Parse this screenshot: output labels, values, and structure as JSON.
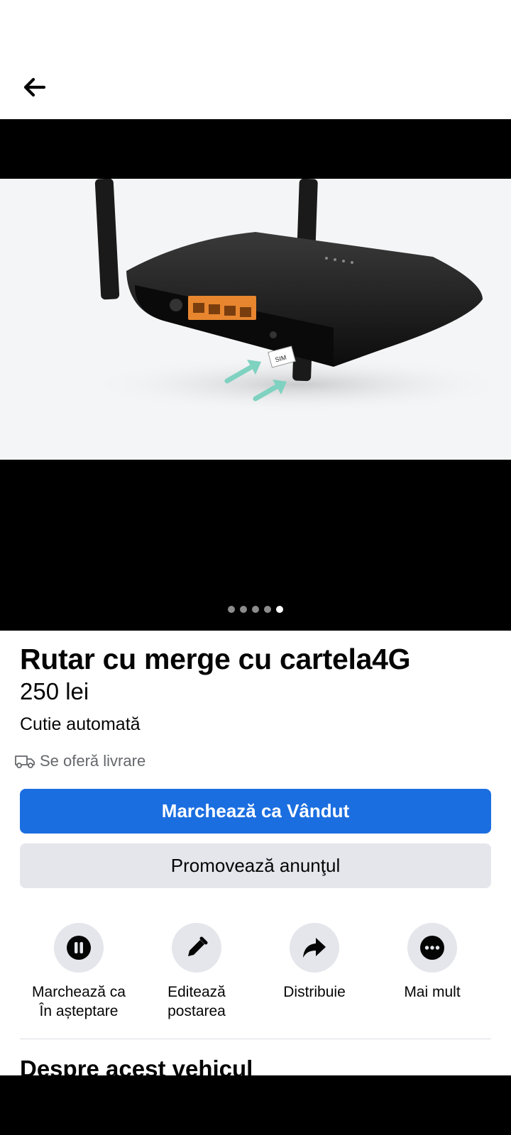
{
  "header": {
    "back_icon": "arrow-left-icon"
  },
  "gallery": {
    "image_alt": "TP-Link 4G LTE router with SIM card slot",
    "image_count": 5,
    "active_index": 5
  },
  "listing": {
    "title": "Rutar cu merge cu cartela4G",
    "price": "250 lei",
    "condition": "Cutie automată",
    "delivery_icon": "delivery-truck-icon",
    "delivery": "Se oferă livrare"
  },
  "buttons": {
    "mark_sold": "Marchează ca Vândut",
    "promote": "Promovează anunţul"
  },
  "actions": [
    {
      "icon": "pause-icon",
      "label": "Marchează ca\nÎn așteptare"
    },
    {
      "icon": "pencil-icon",
      "label": "Editează\npostarea"
    },
    {
      "icon": "share-icon",
      "label": "Distribuie"
    },
    {
      "icon": "more-icon",
      "label": "Mai mult"
    }
  ],
  "section": {
    "title": "Despre acest vehicul"
  },
  "colors": {
    "primary": "#1b6ee0",
    "secondary_bg": "#e4e6eb",
    "text": "#050505",
    "muted": "#65676b"
  }
}
